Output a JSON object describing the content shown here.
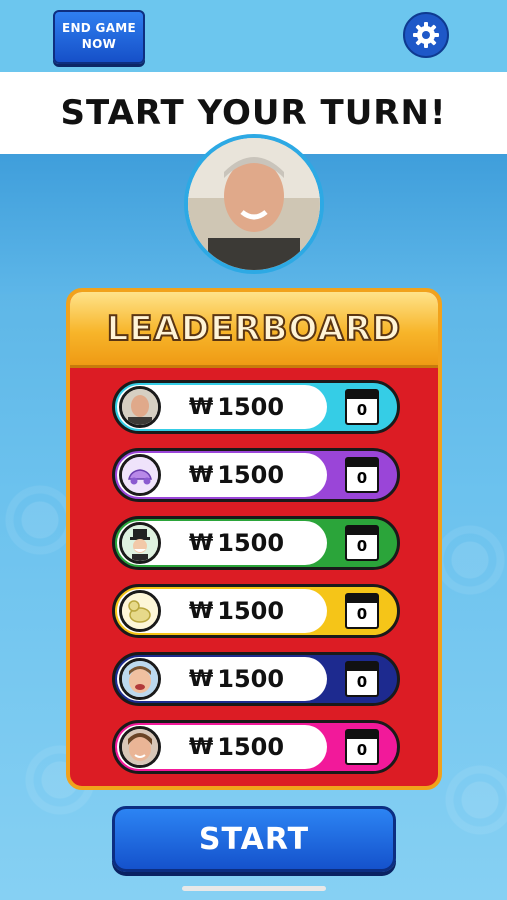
{
  "header": {
    "end_game_label": "END GAME NOW",
    "settings_icon": "gear-icon"
  },
  "banner": {
    "title": "START YOUR TURN!"
  },
  "current_player": {
    "avatar": "player-photo"
  },
  "leaderboard": {
    "title": "LEADERBOARD",
    "currency_symbol": "₩",
    "players": [
      {
        "token": "player-photo",
        "money": "1500",
        "cards": "0",
        "color": "#35cde6"
      },
      {
        "token": "car-token-icon",
        "money": "1500",
        "cards": "0",
        "color": "#9a45d8"
      },
      {
        "token": "mr-monopoly-icon",
        "money": "1500",
        "cards": "0",
        "color": "#2ba53a"
      },
      {
        "token": "dog-token-icon",
        "money": "1500",
        "cards": "0",
        "color": "#f5c518"
      },
      {
        "token": "kid-photo",
        "money": "1500",
        "cards": "0",
        "color": "#1d2a8f"
      },
      {
        "token": "kid-photo",
        "money": "1500",
        "cards": "0",
        "color": "#f2199a"
      }
    ]
  },
  "footer": {
    "start_label": "START"
  }
}
